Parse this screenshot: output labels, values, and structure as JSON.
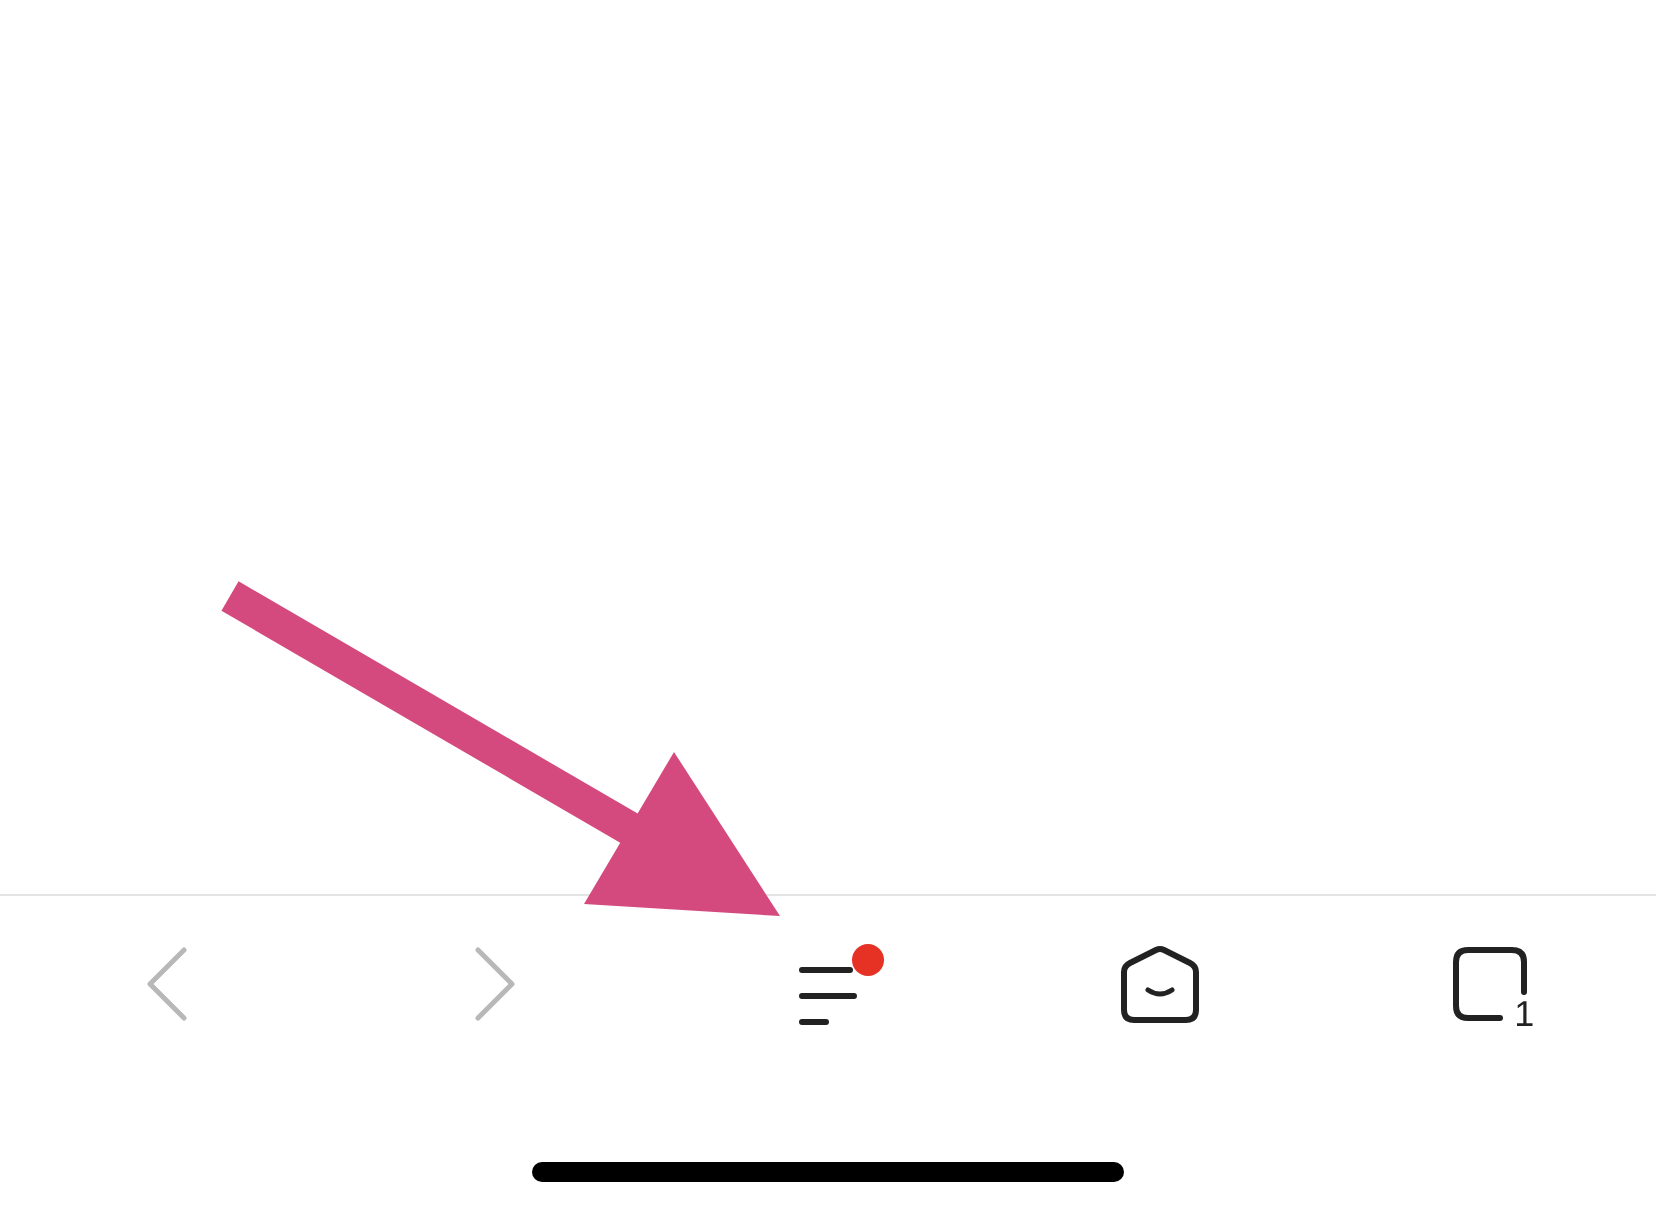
{
  "toolbar": {
    "buttons": [
      {
        "kind": "back",
        "disabled": true
      },
      {
        "kind": "forward",
        "disabled": true
      },
      {
        "kind": "menu",
        "disabled": false,
        "badge": true
      },
      {
        "kind": "home",
        "disabled": false
      },
      {
        "kind": "tabs",
        "disabled": false,
        "count": "1"
      }
    ]
  }
}
